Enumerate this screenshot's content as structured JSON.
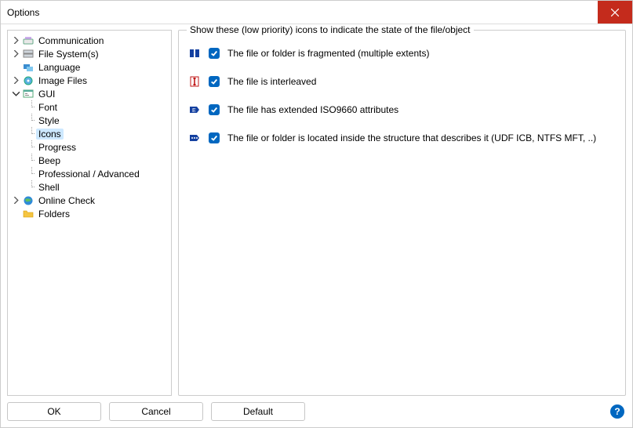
{
  "window": {
    "title": "Options"
  },
  "tree": {
    "communication": "Communication",
    "filesystems": "File System(s)",
    "language": "Language",
    "imagefiles": "Image Files",
    "gui": "GUI",
    "font": "Font",
    "style": "Style",
    "icons": "Icons",
    "progress": "Progress",
    "beep": "Beep",
    "professional": "Professional / Advanced",
    "shell": "Shell",
    "onlinecheck": "Online Check",
    "folders": "Folders"
  },
  "group": {
    "title": "Show these (low priority) icons to indicate the state of the file/object"
  },
  "options": {
    "fragmented": "The file or folder is fragmented (multiple extents)",
    "interleaved": "The file is interleaved",
    "iso9660": "The file has extended ISO9660 attributes",
    "inside": "The file or folder is located inside the structure that describes it (UDF ICB, NTFS MFT, ..)"
  },
  "buttons": {
    "ok": "OK",
    "cancel": "Cancel",
    "default": "Default"
  }
}
